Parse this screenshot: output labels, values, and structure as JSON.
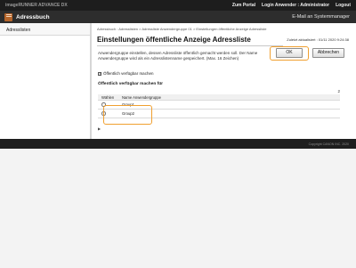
{
  "topbar": {
    "machine": "imageRUNNER ADVANCE DX",
    "nav": [
      "Zum Portal",
      "Login Anwender : Administrator",
      "Logout"
    ]
  },
  "titlebar": {
    "app_title": "Adressbuch",
    "email_link": "E-Mail an Systemmanager"
  },
  "sidebar": {
    "items": [
      {
        "label": "Adresslisten"
      }
    ]
  },
  "main": {
    "breadcrumb": "Adressbuch : Adresslisten > Adressliste Anwendergruppe 01 > Einstellungen öffentliche Anzeige Adressliste",
    "title": "Einstellungen öffentliche Anzeige Adressliste",
    "updated": "Zuletzt aktualisiert : 01/11 2020 9:24:38",
    "ok_label": "OK",
    "cancel_label": "Abbrechen",
    "description": "Anwendergruppe einstellen, dessen Adressliste öffentlich gemacht werden soll. Der Name Anwendergruppe wird als ein Adresslistenname gespeichert. (Max. 16 Zeichen)",
    "public_checkbox_label": "Öffentlich verfügbar machen",
    "section_title": "Öffentlich verfügbar machen für",
    "page_count": "2",
    "table": {
      "headers": [
        "Wählen",
        "Name Anwendergruppe"
      ],
      "rows": [
        {
          "name": "Group1"
        },
        {
          "name": "Group2"
        }
      ]
    },
    "pager": "▶"
  },
  "footer": {
    "copyright": "Copyright CANON INC. 2020"
  },
  "colors": {
    "highlight": "#f0a030",
    "topbar": "#1d1d1d",
    "titlebar": "#2d2d2d"
  }
}
